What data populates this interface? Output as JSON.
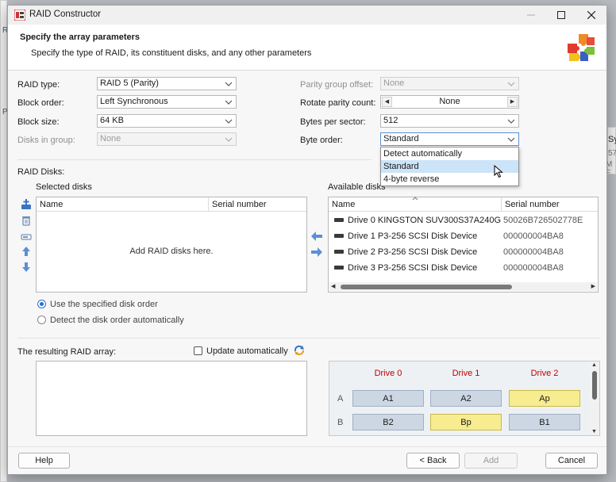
{
  "window": {
    "title": "RAID Constructor"
  },
  "background": {
    "left_a": "R",
    "left_b": "P",
    "right_a": "Sy",
    "right_b": "57",
    "right_c": "M F"
  },
  "header": {
    "title": "Specify the array parameters",
    "subtitle": "Specify the type of RAID, its constituent disks, and any other parameters"
  },
  "params": {
    "raid_type": {
      "label": "RAID type:",
      "value": "RAID 5 (Parity)"
    },
    "block_order": {
      "label": "Block order:",
      "value": "Left Synchronous"
    },
    "block_size": {
      "label": "Block size:",
      "value": "64 KB"
    },
    "disks_in_group": {
      "label": "Disks in group:",
      "value": "None"
    },
    "parity_offset": {
      "label": "Parity group offset:",
      "value": "None"
    },
    "rotate_parity": {
      "label": "Rotate parity count:",
      "value": "None"
    },
    "bytes_per_sector": {
      "label": "Bytes per sector:",
      "value": "512"
    },
    "byte_order": {
      "label": "Byte order:",
      "value": "Standard",
      "options": [
        "Detect automatically",
        "Standard",
        "4-byte reverse"
      ],
      "selected_index": 1
    }
  },
  "raid_disks": {
    "label": "RAID Disks:",
    "selected": {
      "label": "Selected disks",
      "col_name": "Name",
      "col_serial": "Serial number",
      "placeholder": "Add RAID disks here."
    },
    "available": {
      "label": "Available disks",
      "col_name": "Name",
      "col_serial": "Serial number",
      "rows": [
        {
          "name": "Drive 0 KINGSTON SUV300S37A240G",
          "serial": "50026B726502778E"
        },
        {
          "name": "Drive 1 P3-256  SCSI Disk Device",
          "serial": "000000004BA8"
        },
        {
          "name": "Drive 2 P3-256  SCSI Disk Device",
          "serial": "000000004BA8"
        },
        {
          "name": "Drive 3 P3-256  SCSI Disk Device",
          "serial": "000000004BA8"
        }
      ]
    },
    "order_options": {
      "specified": "Use the specified disk order",
      "auto": "Detect the disk order automatically"
    }
  },
  "result": {
    "label": "The resulting RAID array:",
    "update_auto": "Update automatically",
    "grid": {
      "drives": [
        "Drive 0",
        "Drive 1",
        "Drive 2"
      ],
      "rows": [
        {
          "label": "A",
          "cells": [
            {
              "text": "A1",
              "parity": false
            },
            {
              "text": "A2",
              "parity": false
            },
            {
              "text": "Ap",
              "parity": true
            }
          ]
        },
        {
          "label": "B",
          "cells": [
            {
              "text": "B2",
              "parity": false
            },
            {
              "text": "Bp",
              "parity": true
            },
            {
              "text": "B1",
              "parity": false
            }
          ]
        }
      ]
    }
  },
  "buttons": {
    "help": "Help",
    "back": "< Back",
    "add": "Add",
    "cancel": "Cancel"
  },
  "colors": {
    "accent": "#2a6fd1",
    "drive_header": "#c00000",
    "data_cell": "#cdd7e3",
    "parity_cell": "#f7ec8f"
  }
}
